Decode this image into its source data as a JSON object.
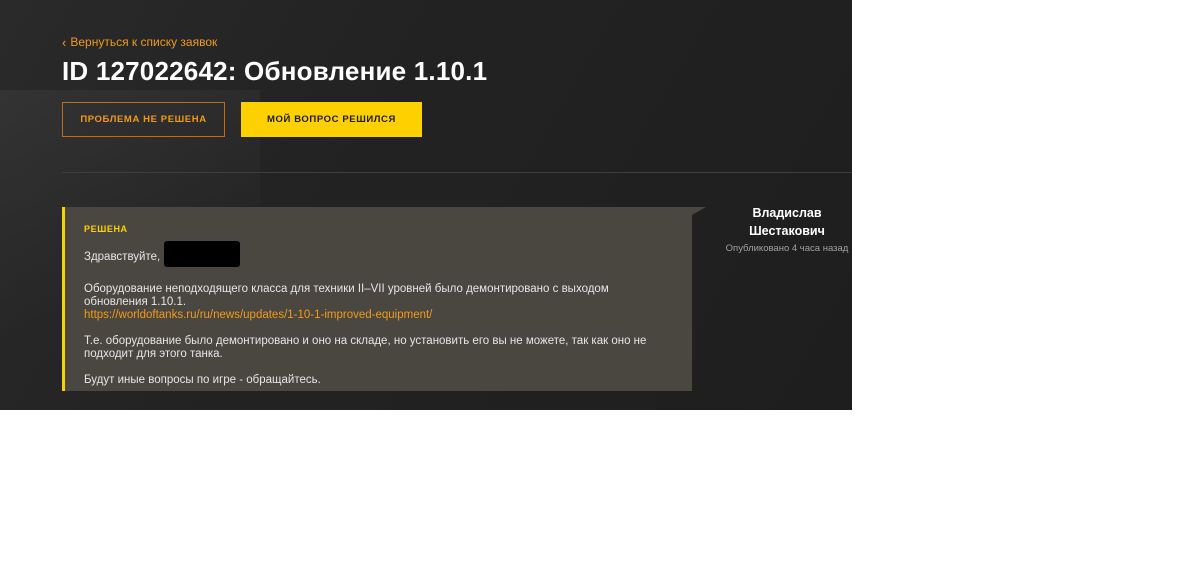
{
  "header": {
    "back_label": "Вернуться к списку заявок",
    "title": "ID 127022642: Обновление 1.10.1"
  },
  "actions": {
    "not_solved_label": "ПРОБЛЕМА НЕ РЕШЕНА",
    "solved_label": "МОЙ ВОПРОС РЕШИЛСЯ"
  },
  "message": {
    "status": "РЕШЕНА",
    "greeting": "Здравствуйте,",
    "paragraph1": "Оборудование неподходящего класса для техники II–VII уровней было демонтировано с выходом обновления 1.10.1.",
    "link": "https://worldoftanks.ru/ru/news/updates/1-10-1-improved-equipment/",
    "paragraph2": "Т.е. оборудование было демонтировано и оно на складе, но установить его вы не можете, так как оно не подходит для этого танка.",
    "paragraph3": "Будут иные вопросы по игре - обращайтесь."
  },
  "author": {
    "name_line1": "Владислав",
    "name_line2": "Шестакович",
    "published": "Опубликовано 4 часа назад"
  },
  "colors": {
    "accent_yellow": "#ffd000",
    "accent_orange": "#f29a1d",
    "background": "#232323",
    "message_bg": "#4a4640"
  },
  "icons": {
    "back": "chevron-left-icon"
  }
}
